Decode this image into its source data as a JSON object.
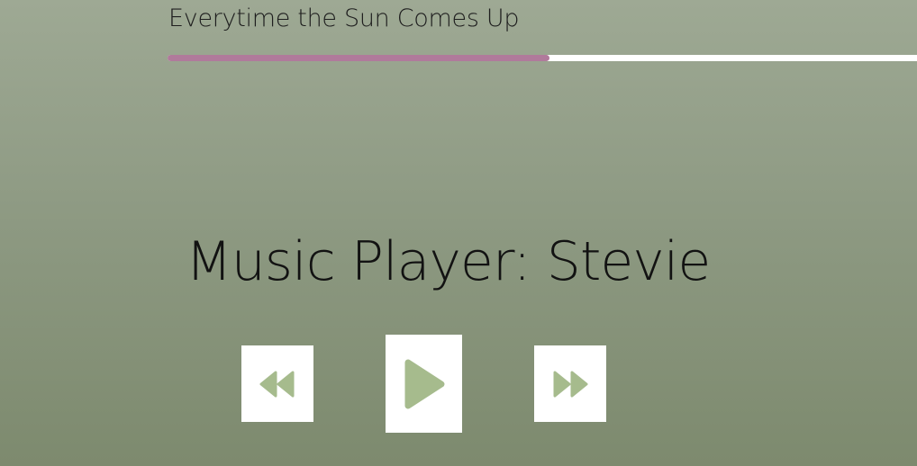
{
  "song": {
    "title": "Everytime the Sun Comes Up"
  },
  "progress": {
    "fraction": 0.51,
    "fill_color": "#b07a9b",
    "track_color": "#ffffff"
  },
  "player": {
    "heading": "Music Player: Stevie"
  },
  "controls": {
    "icon_color": "#a6bb8d",
    "prev_icon": "rewind-icon",
    "play_icon": "play-icon",
    "next_icon": "fast-forward-icon"
  }
}
